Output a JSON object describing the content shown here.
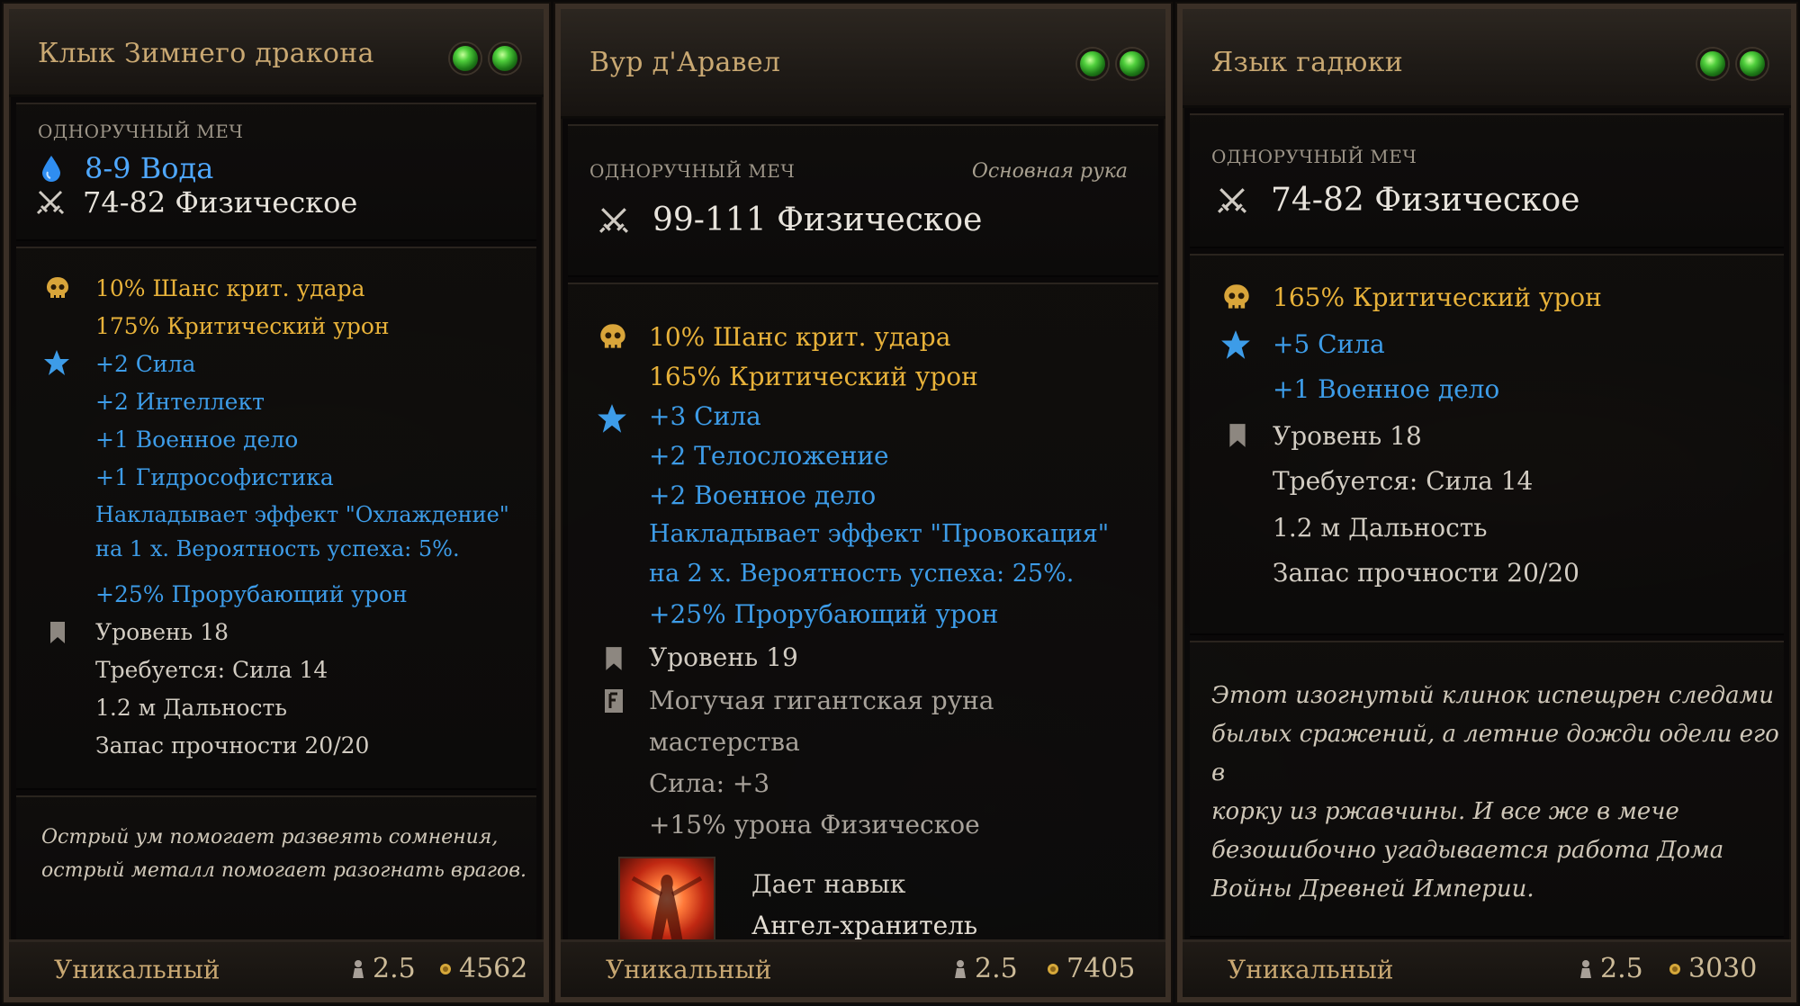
{
  "colors": {
    "title": "#c9a872",
    "gold_stat": "#e8b23a",
    "blue_stat": "#3d9ce8",
    "water": "#4fa8ff",
    "gem_green": "#4fcf3c"
  },
  "tooltips": [
    {
      "title": "Клык Зимнего дракона",
      "gem_count": 2,
      "base_type": "одноручный меч",
      "damage": [
        {
          "icon": "water-drop-icon",
          "text": "8-9 Вода"
        },
        {
          "icon": "crossed-swords-icon",
          "text": "74-82 Физическое"
        }
      ],
      "stats": [
        {
          "icon": "skull-icon",
          "color": "gold",
          "text": "10% Шанс крит. удара"
        },
        {
          "color": "gold",
          "text": "175% Критический урон"
        },
        {
          "icon": "star-icon",
          "color": "blue",
          "text": "+2 Сила"
        },
        {
          "color": "blue",
          "text": "+2 Интеллект"
        },
        {
          "color": "blue",
          "text": "+1 Военное дело"
        },
        {
          "color": "blue",
          "text": "+1 Гидрософистика"
        },
        {
          "color": "blue",
          "text": "Накладывает эффект \"Охлаждение\""
        },
        {
          "color": "blue",
          "text": "на 1 х. Вероятность успеха: 5%."
        },
        {
          "color": "blue",
          "text": "+25% Прорубающий урон"
        },
        {
          "icon": "bookmark-icon",
          "color": "white",
          "text": "Уровень 18"
        },
        {
          "color": "white",
          "text": "Требуется: Сила 14"
        },
        {
          "color": "white",
          "text": "1.2 м Дальность"
        },
        {
          "color": "white",
          "text": "Запас прочности 20/20"
        }
      ],
      "lore": [
        "Острый ум помогает развеять сомнения,",
        "острый металл помогает разогнать врагов."
      ],
      "rarity": "Уникальный",
      "weight": "2.5",
      "price": "4562"
    },
    {
      "title": "Вур д'Аравел",
      "gem_count": 2,
      "base_type": "одноручный меч",
      "hand": "Основная рука",
      "damage": [
        {
          "icon": "crossed-swords-icon",
          "text": "99-111 Физическое"
        }
      ],
      "stats": [
        {
          "icon": "skull-icon",
          "color": "gold",
          "text": "10% Шанс крит. удара"
        },
        {
          "color": "gold",
          "text": "165% Критический урон"
        },
        {
          "icon": "star-icon",
          "color": "blue",
          "text": "+3 Сила"
        },
        {
          "color": "blue",
          "text": "+2 Телосложение"
        },
        {
          "color": "blue",
          "text": "+2 Военное дело"
        },
        {
          "color": "blue",
          "text": "Накладывает эффект \"Провокация\""
        },
        {
          "color": "blue",
          "text": "на 2 х. Вероятность успеха: 25%."
        },
        {
          "color": "blue",
          "text": "+25% Прорубающий урон"
        },
        {
          "icon": "bookmark-icon",
          "color": "white",
          "text": "Уровень 19"
        },
        {
          "icon": "rune-icon",
          "color": "grey",
          "text": "Могучая гигантская руна"
        },
        {
          "color": "grey",
          "text": "мастерства"
        },
        {
          "color": "grey",
          "text": "Сила: +3"
        },
        {
          "color": "grey",
          "text": "+15% урона Физическое"
        }
      ],
      "skill": {
        "icon": "guardian-angel-skill-icon",
        "line1": "Дает навык",
        "line2": "Ангел-хранитель"
      },
      "rarity": "Уникальный",
      "weight": "2.5",
      "price": "7405"
    },
    {
      "title": "Язык гадюки",
      "gem_count": 2,
      "base_type": "одноручный меч",
      "damage": [
        {
          "icon": "crossed-swords-icon",
          "text": "74-82 Физическое"
        }
      ],
      "stats": [
        {
          "icon": "skull-icon",
          "color": "gold",
          "text": "165% Критический урон"
        },
        {
          "icon": "star-icon",
          "color": "blue",
          "text": "+5 Сила"
        },
        {
          "color": "blue",
          "text": "+1 Военное дело"
        },
        {
          "icon": "bookmark-icon",
          "color": "white",
          "text": "Уровень 18"
        },
        {
          "color": "white",
          "text": "Требуется: Сила 14"
        },
        {
          "color": "white",
          "text": "1.2 м Дальность"
        },
        {
          "color": "white",
          "text": "Запас прочности 20/20"
        }
      ],
      "lore": [
        "Этот изогнутый клинок испещрен следами",
        "былых сражений, а летние дожди одели его в",
        "корку из ржавчины. И все же в мече",
        "безошибочно угадывается работа Дома",
        "Войны Древней Империи."
      ],
      "rarity": "Уникальный",
      "weight": "2.5",
      "price": "3030"
    }
  ]
}
